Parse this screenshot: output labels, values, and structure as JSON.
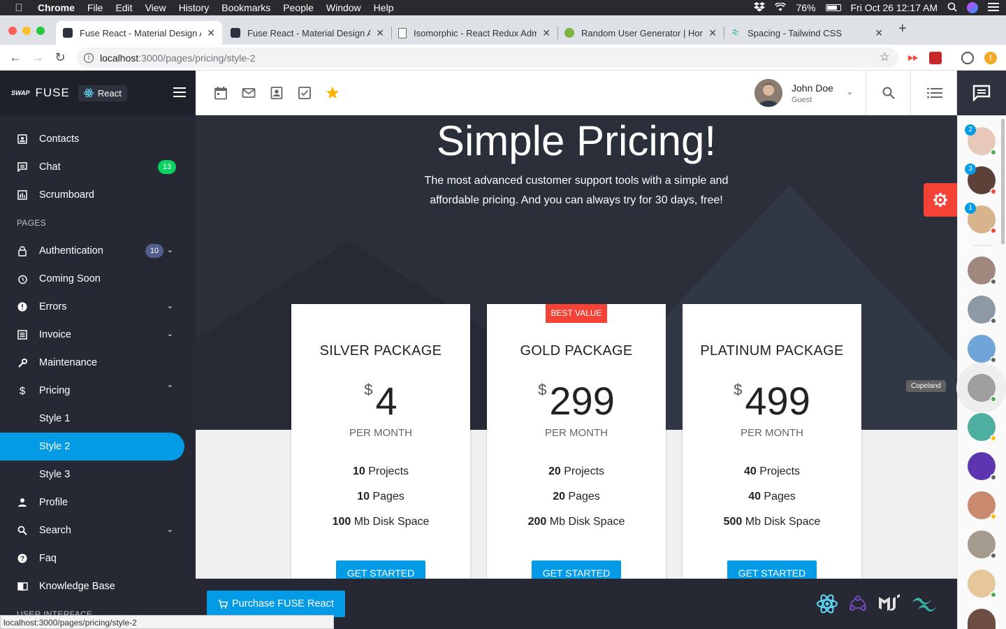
{
  "os": {
    "app_name": "Chrome",
    "menu": [
      "File",
      "Edit",
      "View",
      "History",
      "Bookmarks",
      "People",
      "Window",
      "Help"
    ],
    "battery": "76%",
    "datetime": "Fri Oct 26  12:17 AM"
  },
  "browser": {
    "tabs": [
      {
        "title": "Fuse React - Material Design A",
        "active": true
      },
      {
        "title": "Fuse React - Material Design A",
        "active": false
      },
      {
        "title": "Isomorphic - React Redux Adm",
        "active": false
      },
      {
        "title": "Random User Generator | Hom",
        "active": false
      },
      {
        "title": "Spacing - Tailwind CSS",
        "active": false
      }
    ],
    "url_host": "localhost",
    "url_path": ":3000/pages/pricing/style-2",
    "status_url": "localhost:3000/pages/pricing/style-2"
  },
  "sidebar": {
    "logo_text": "FUSE",
    "logo_small": "SWAP",
    "react_badge": "React",
    "items": [
      {
        "label": "Contacts",
        "icon": "contacts-icon"
      },
      {
        "label": "Chat",
        "icon": "chat-icon",
        "badge": "13",
        "badge_color": "#09d261"
      },
      {
        "label": "Scrumboard",
        "icon": "scrumboard-icon"
      }
    ],
    "pages_header": "PAGES",
    "pages": [
      {
        "label": "Authentication",
        "icon": "lock-icon",
        "badge": "10",
        "badge_color": "#525e8a",
        "expandable": true
      },
      {
        "label": "Coming Soon",
        "icon": "alarm-icon"
      },
      {
        "label": "Errors",
        "icon": "error-icon",
        "expandable": true
      },
      {
        "label": "Invoice",
        "icon": "invoice-icon",
        "expandable": true
      },
      {
        "label": "Maintenance",
        "icon": "wrench-icon"
      },
      {
        "label": "Pricing",
        "icon": "dollar-icon",
        "expanded": true
      },
      {
        "label": "Style 1",
        "sub": true
      },
      {
        "label": "Style 2",
        "sub": true,
        "active": true
      },
      {
        "label": "Style 3",
        "sub": true
      },
      {
        "label": "Profile",
        "icon": "person-icon"
      },
      {
        "label": "Search",
        "icon": "search-icon",
        "expandable": true
      },
      {
        "label": "Faq",
        "icon": "help-icon"
      },
      {
        "label": "Knowledge Base",
        "icon": "book-icon"
      }
    ],
    "next_header": "USER INTERFACE"
  },
  "header": {
    "user_name": "John Doe",
    "user_role": "Guest"
  },
  "hero": {
    "title": "Simple Pricing!",
    "subtitle": "The most advanced customer support tools with a simple and affordable pricing. And you can always try for 30 days, free!"
  },
  "plans": [
    {
      "name": "SILVER PACKAGE",
      "currency": "$",
      "price": "4",
      "period": "PER MONTH",
      "features": [
        {
          "num": "10",
          "text": " Projects"
        },
        {
          "num": "10",
          "text": " Pages"
        },
        {
          "num": "100",
          "text": " Mb Disk Space"
        }
      ],
      "cta": "GET STARTED"
    },
    {
      "name": "GOLD PACKAGE",
      "currency": "$",
      "price": "299",
      "period": "PER MONTH",
      "ribbon": "BEST VALUE",
      "features": [
        {
          "num": "20",
          "text": " Projects"
        },
        {
          "num": "20",
          "text": " Pages"
        },
        {
          "num": "200",
          "text": " Mb Disk Space"
        }
      ],
      "cta": "GET STARTED"
    },
    {
      "name": "PLATINUM PACKAGE",
      "currency": "$",
      "price": "499",
      "period": "PER MONTH",
      "features": [
        {
          "num": "40",
          "text": " Projects"
        },
        {
          "num": "40",
          "text": " Pages"
        },
        {
          "num": "500",
          "text": " Mb Disk Space"
        }
      ],
      "cta": "GET STARTED"
    }
  ],
  "footer": {
    "purchase_label": "Purchase FUSE React"
  },
  "chat": {
    "tooltip": "Copeland",
    "unread": [
      "2",
      "3",
      "1"
    ]
  },
  "colors": {
    "accent": "#039be5",
    "danger": "#f44336",
    "sidebar_bg": "#262933",
    "hero_bg": "#2b2f3a"
  }
}
